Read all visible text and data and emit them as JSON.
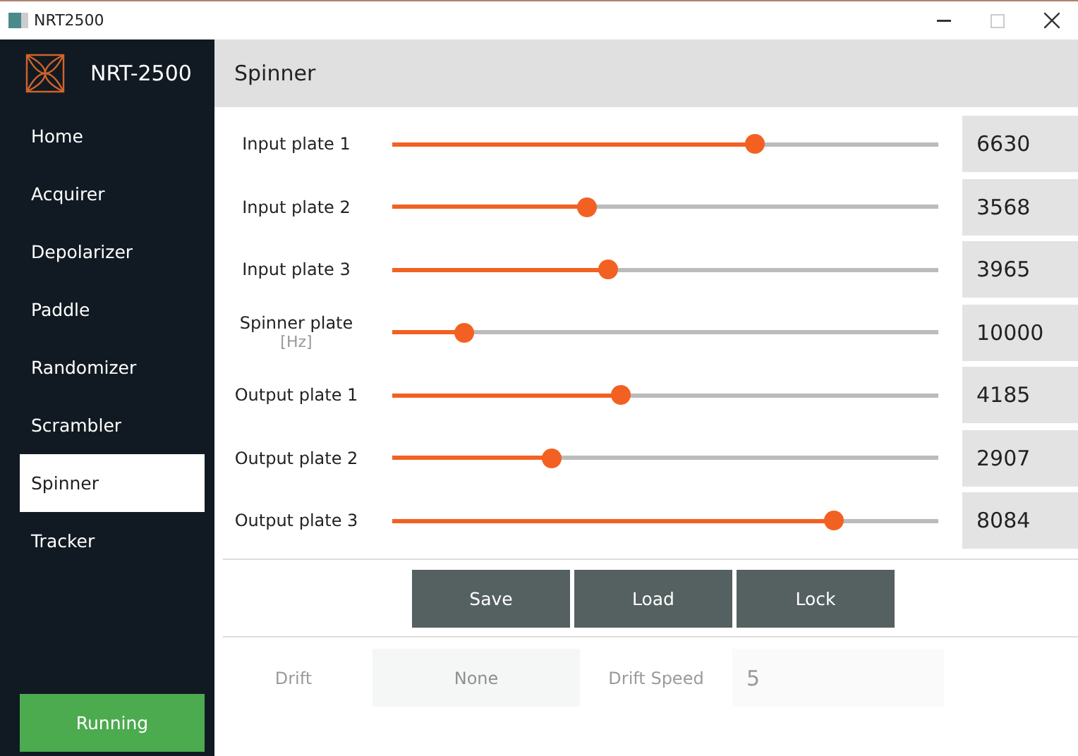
{
  "window": {
    "title": "NRT2500"
  },
  "sidebar": {
    "brand": "NRT-2500",
    "items": [
      {
        "label": "Home",
        "selected": false
      },
      {
        "label": "Acquirer",
        "selected": false
      },
      {
        "label": "Depolarizer",
        "selected": false
      },
      {
        "label": "Paddle",
        "selected": false
      },
      {
        "label": "Randomizer",
        "selected": false
      },
      {
        "label": "Scrambler",
        "selected": false
      },
      {
        "label": "Spinner",
        "selected": true
      },
      {
        "label": "Tracker",
        "selected": false
      }
    ],
    "status": "Running"
  },
  "header": "Spinner",
  "sliders": [
    {
      "label": "Input plate 1",
      "level": 0.664,
      "value": "6630"
    },
    {
      "label": "Input plate 2",
      "level": 0.357,
      "value": "3568"
    },
    {
      "label": "Input plate 3",
      "level": 0.395,
      "value": "3965"
    },
    {
      "label": "Spinner plate",
      "unit": "[Hz]",
      "level": 0.132,
      "value": "10000"
    },
    {
      "label": "Output plate 1",
      "level": 0.419,
      "value": "4185"
    },
    {
      "label": "Output plate 2",
      "level": 0.292,
      "value": "2907"
    },
    {
      "label": "Output plate 3",
      "level": 0.809,
      "value": "8084"
    }
  ],
  "buttons": [
    "Save",
    "Load",
    "Lock"
  ],
  "drift": {
    "disabled": true,
    "label": "Drift",
    "value": "None",
    "speed_label": "Drift Speed",
    "speed_value": "5"
  }
}
